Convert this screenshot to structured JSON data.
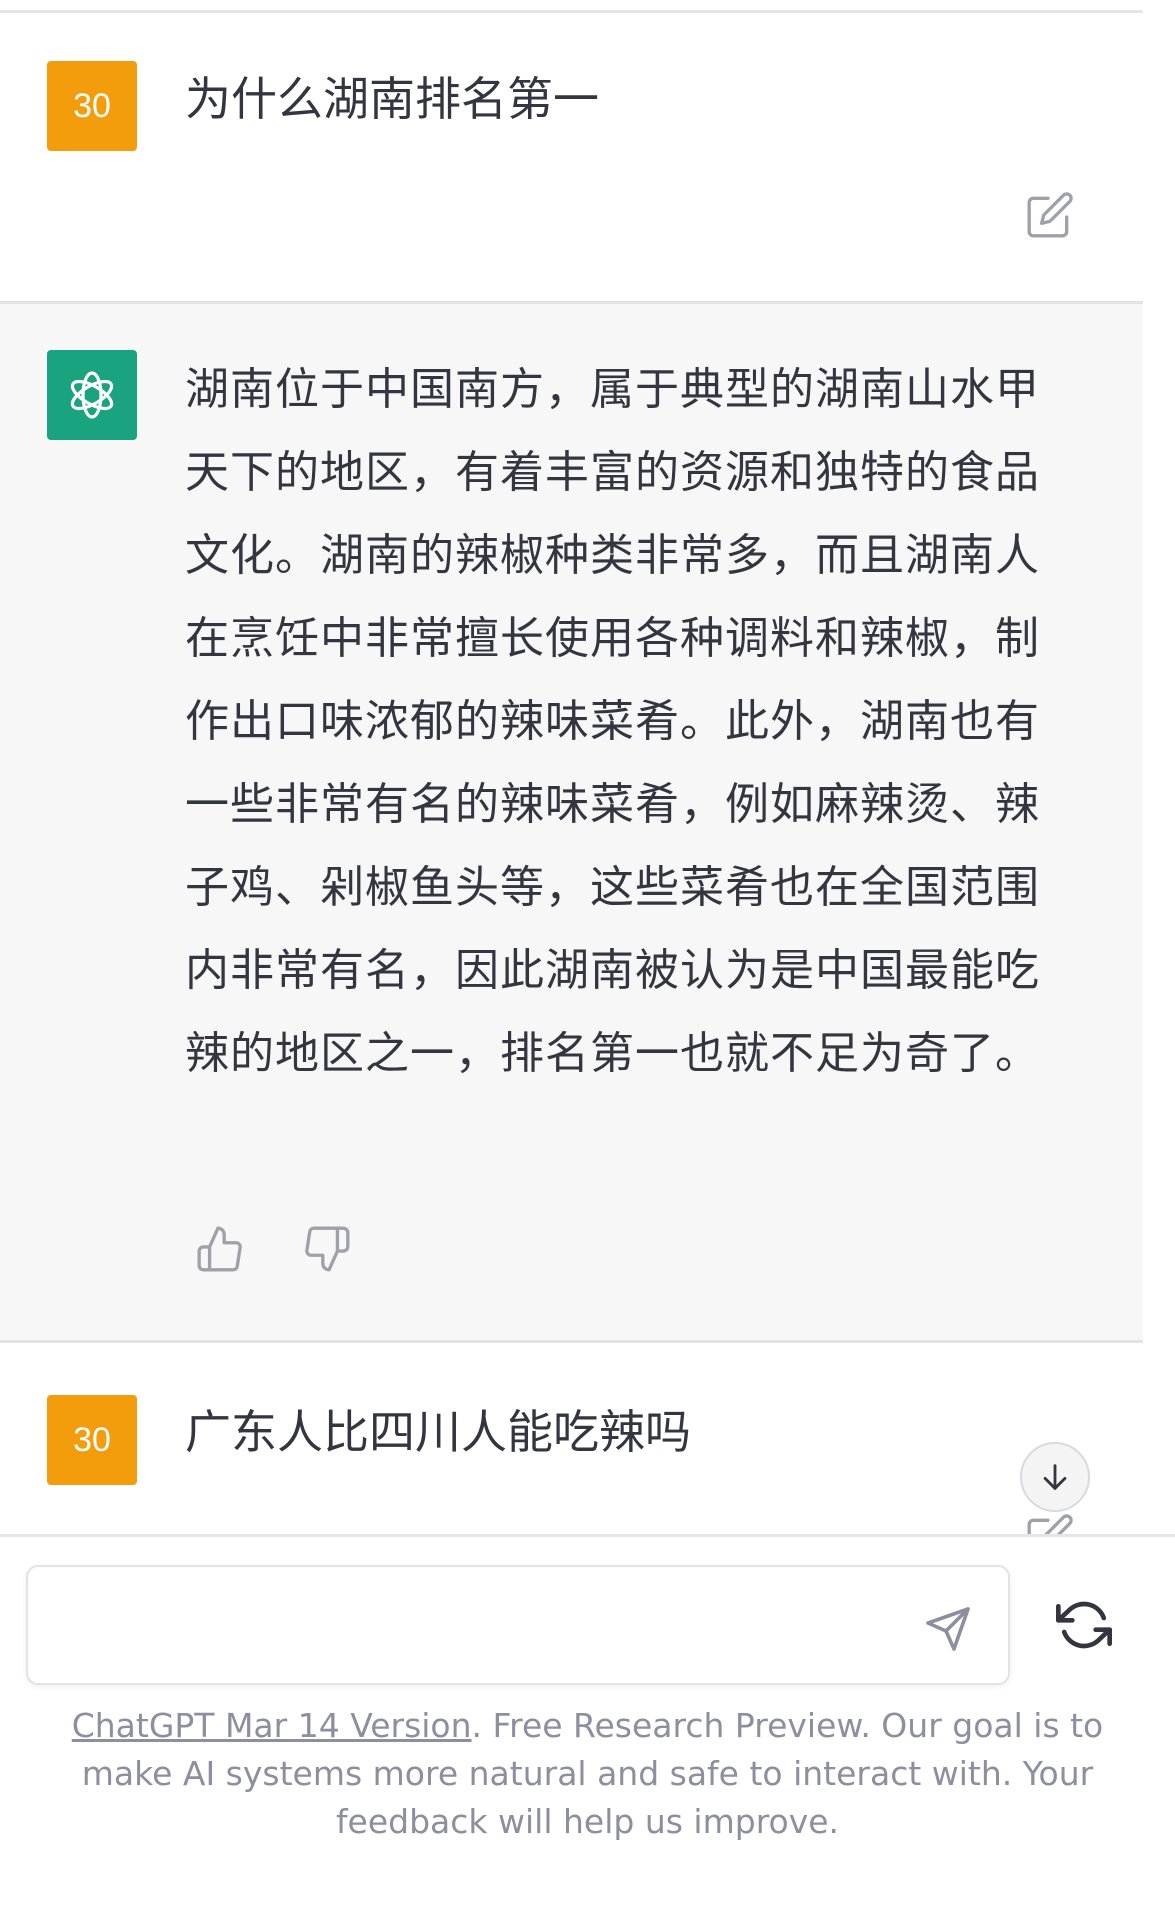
{
  "conversation": {
    "user_msg_1": {
      "avatar_text": "30",
      "text": "为什么湖南排名第一"
    },
    "bot_msg": {
      "text": "湖南位于中国南方，属于典型的湖南山水甲天下的地区，有着丰富的资源和独特的食品文化。湖南的辣椒种类非常多，而且湖南人在烹饪中非常擅长使用各种调料和辣椒，制作出口味浓郁的辣味菜肴。此外，湖南也有一些非常有名的辣味菜肴，例如麻辣烫、辣子鸡、剁椒鱼头等，这些菜肴也在全国范围内非常有名，因此湖南被认为是中国最能吃辣的地区之一，排名第一也就不足为奇了。"
    },
    "user_msg_2": {
      "avatar_text": "30",
      "text": "广东人比四川人能吃辣吗"
    }
  },
  "composer": {
    "input_value": "",
    "input_placeholder": ""
  },
  "footer": {
    "link_text": "ChatGPT Mar 14 Version",
    "text": ". Free Research Preview. Our goal is to make AI systems more natural and safe to interact with. Your feedback will help us improve."
  },
  "colors": {
    "user_avatar": "#f49d0c",
    "bot_avatar": "#19a37f",
    "bot_bg": "#f7f7f8",
    "text": "#343541",
    "muted": "#8e8ea0"
  },
  "icons": [
    "edit-icon",
    "openai-logo-icon",
    "thumbs-up-icon",
    "thumbs-down-icon",
    "arrow-down-icon",
    "send-icon",
    "regenerate-icon"
  ]
}
